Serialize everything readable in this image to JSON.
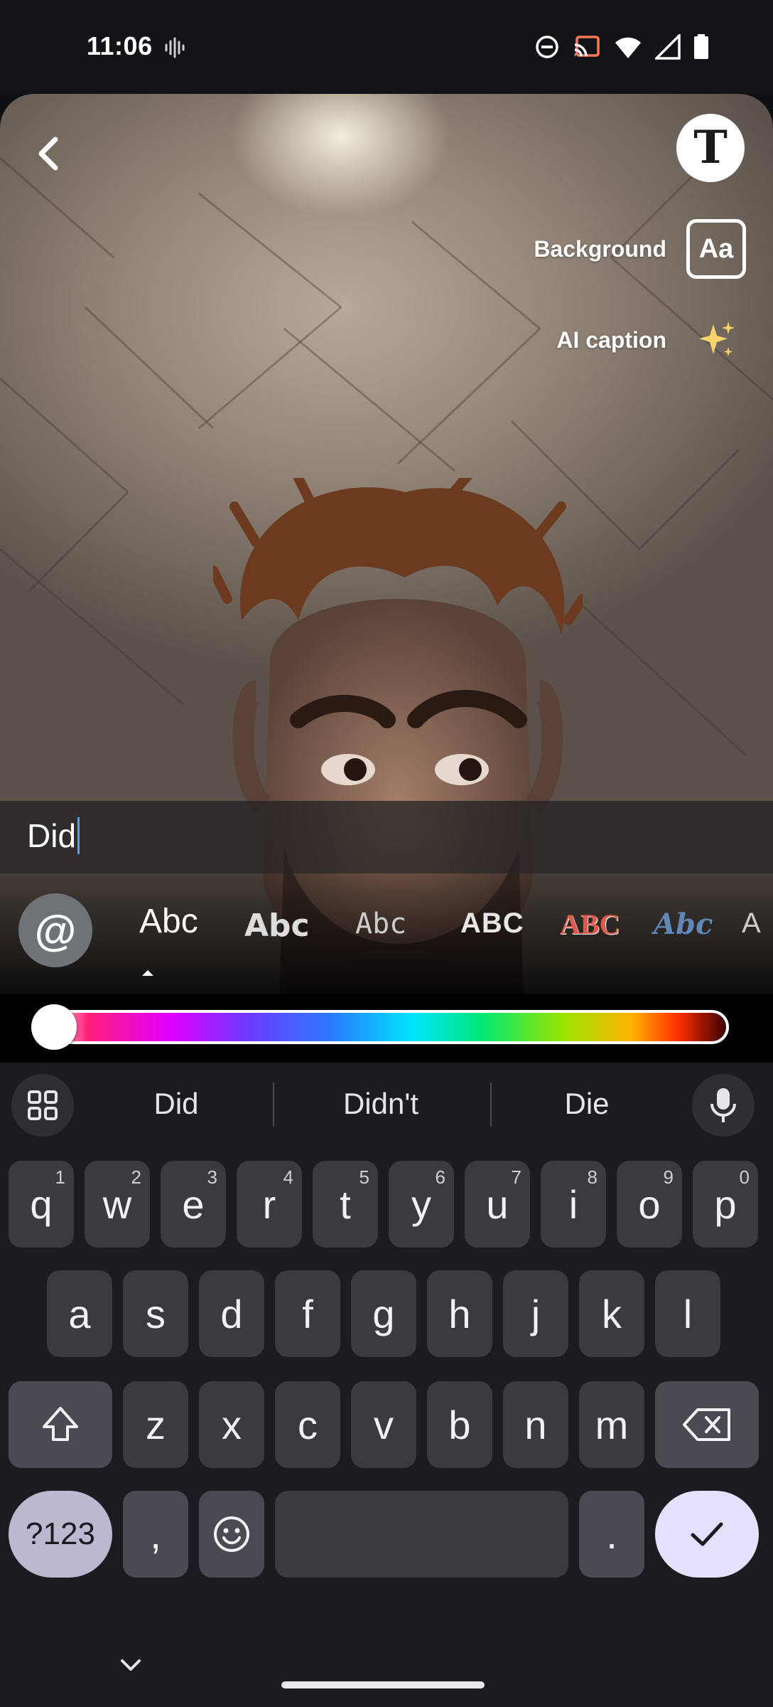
{
  "status": {
    "time": "11:06"
  },
  "editor": {
    "background_label": "Background",
    "background_icon_text": "Aa",
    "ai_caption_label": "AI caption",
    "text_tool_glyph": "T",
    "caption_text": "Did"
  },
  "fonts": {
    "at_symbol": "@",
    "items": [
      "Abc",
      "Abc",
      "Abc",
      "ABC",
      "ABC",
      "Abc",
      "A"
    ]
  },
  "suggestions": [
    "Did",
    "Didn't",
    "Die"
  ],
  "keys": {
    "row1": [
      {
        "k": "q",
        "n": "1"
      },
      {
        "k": "w",
        "n": "2"
      },
      {
        "k": "e",
        "n": "3"
      },
      {
        "k": "r",
        "n": "4"
      },
      {
        "k": "t",
        "n": "5"
      },
      {
        "k": "y",
        "n": "6"
      },
      {
        "k": "u",
        "n": "7"
      },
      {
        "k": "i",
        "n": "8"
      },
      {
        "k": "o",
        "n": "9"
      },
      {
        "k": "p",
        "n": "0"
      }
    ],
    "row2": [
      "a",
      "s",
      "d",
      "f",
      "g",
      "h",
      "j",
      "k",
      "l"
    ],
    "row3": [
      "z",
      "x",
      "c",
      "v",
      "b",
      "n",
      "m"
    ],
    "symbols": "?123",
    "comma": ",",
    "period": "."
  },
  "colors": {
    "accent_caret": "#4aa3ff",
    "done_key": "#e6e0ff",
    "symbols_key": "#bdb7cf"
  }
}
